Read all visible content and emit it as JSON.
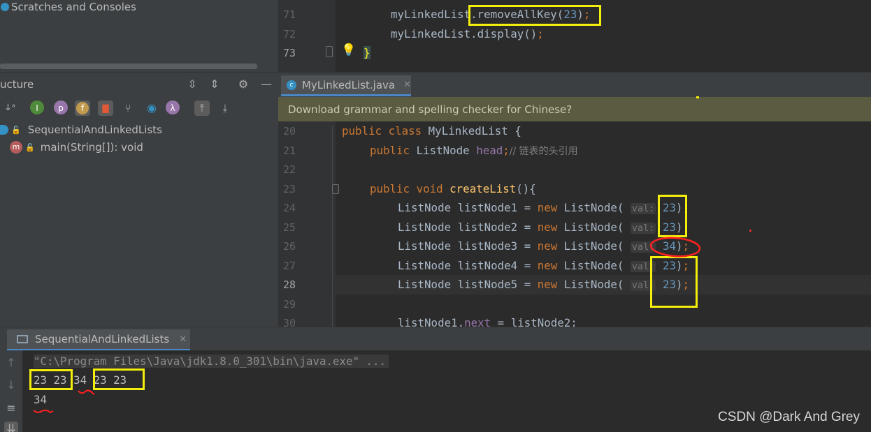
{
  "project_tree": {
    "scratches_label": "Scratches and Consoles"
  },
  "structure": {
    "title": "ucture",
    "class_name": "SequentialAndLinkedLists",
    "method": "main(String[]): void"
  },
  "editor_top": {
    "lines": [
      {
        "n": "71",
        "indent": "        ",
        "obj": "myLinkedList",
        "method": "removeAllKey",
        "arg": "23"
      },
      {
        "n": "72",
        "indent": "        ",
        "obj": "myLinkedList",
        "method": "display",
        "arg": ""
      },
      {
        "n": "73",
        "brace": "}"
      }
    ]
  },
  "tab": {
    "file_name": "MyLinkedList.java"
  },
  "banner": {
    "text": "Download grammar and spelling checker for Chinese?"
  },
  "code": {
    "line20": {
      "n": "20",
      "kw1": "public",
      "kw2": "class",
      "name": "MyLinkedList",
      "rest": " {"
    },
    "line21": {
      "n": "21",
      "kw": "public",
      "type": "ListNode",
      "field": "head",
      "comment": "// 链表的头引用"
    },
    "line22": {
      "n": "22"
    },
    "line23": {
      "n": "23",
      "kw1": "public",
      "kw2": "void",
      "method": "createList",
      "rest": "(){"
    },
    "nodes": [
      {
        "n": "24",
        "decl": "ListNode listNode1 = ",
        "kw": "new",
        "ctor": " ListNode(",
        "hint": "val:",
        "val": "23"
      },
      {
        "n": "25",
        "decl": "ListNode listNode2 = ",
        "kw": "new",
        "ctor": " ListNode(",
        "hint": "val:",
        "val": "23"
      },
      {
        "n": "26",
        "decl": "ListNode listNode3 = ",
        "kw": "new",
        "ctor": " ListNode(",
        "hint": "val:",
        "val": "34"
      },
      {
        "n": "27",
        "decl": "ListNode listNode4 = ",
        "kw": "new",
        "ctor": " ListNode(",
        "hint": "val:",
        "val": "23"
      },
      {
        "n": "28",
        "decl": "ListNode listNode5 = ",
        "kw": "new",
        "ctor": " ListNode(",
        "hint": "val:",
        "val": "23"
      }
    ],
    "line29": {
      "n": "29"
    },
    "line30": {
      "n": "30",
      "text": "listNode1.",
      "field": "next",
      "rest": " = listNode2;"
    }
  },
  "run": {
    "tab_label": "SequentialAndLinkedLists",
    "command": "\"C:\\Program Files\\Java\\jdk1.8.0_301\\bin\\java.exe\" ...",
    "output_line1": [
      "23 23",
      "34",
      "23 23"
    ],
    "output_line2": "34"
  },
  "watermark": "CSDN @Dark And Grey",
  "colors": {
    "highlight_box": "#f4ee0c",
    "annotation_red": "#ff2020",
    "keyword": "#cc7832",
    "number": "#6897bb",
    "function": "#ffc66d"
  },
  "icons": {
    "structure_tools": [
      "sort-alpha-icon",
      "inherited-icon",
      "property-icon",
      "field-icon",
      "non-public-icon",
      "expand-tree-icon",
      "anonymous-icon",
      "lambda-icon",
      "scroll-to-source-icon",
      "scroll-from-source-icon"
    ]
  }
}
